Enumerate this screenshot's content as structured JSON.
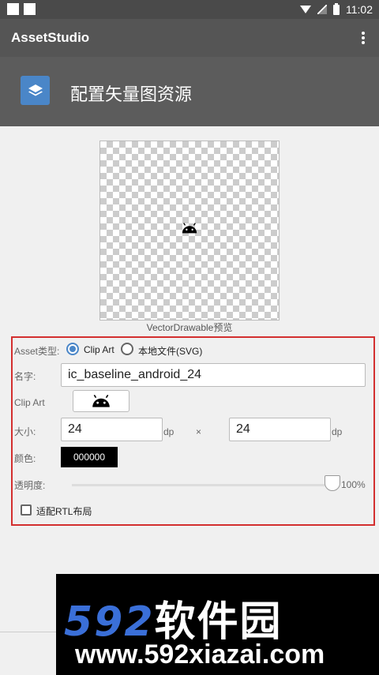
{
  "status_bar": {
    "time": "11:02"
  },
  "app_bar": {
    "title": "AssetStudio"
  },
  "header": {
    "title": "配置矢量图资源",
    "icon": "layers-icon"
  },
  "preview": {
    "caption": "VectorDrawable预览",
    "icon": "android-icon"
  },
  "form": {
    "asset_type_label": "Asset类型:",
    "asset_type_options": [
      "Clip Art",
      "本地文件(SVG)"
    ],
    "asset_type_selected": "Clip Art",
    "name_label": "名字:",
    "name_value": "ic_baseline_android_24",
    "clipart_label": "Clip Art",
    "size_label": "大小:",
    "width_value": "24",
    "height_value": "24",
    "unit": "dp",
    "times": "×",
    "color_label": "颜色:",
    "color_value": "000000",
    "opacity_label": "透明度:",
    "opacity_value": "100%",
    "opacity_fraction": 1.0,
    "rtl_label": "适配RTL布局",
    "rtl_checked": false
  },
  "watermark": {
    "brand": "592",
    "brand_cn": "软件园",
    "url": "www.592xiazai.com"
  },
  "colors": {
    "accent": "#4a86c8",
    "highlight_border": "#d32f2f"
  }
}
